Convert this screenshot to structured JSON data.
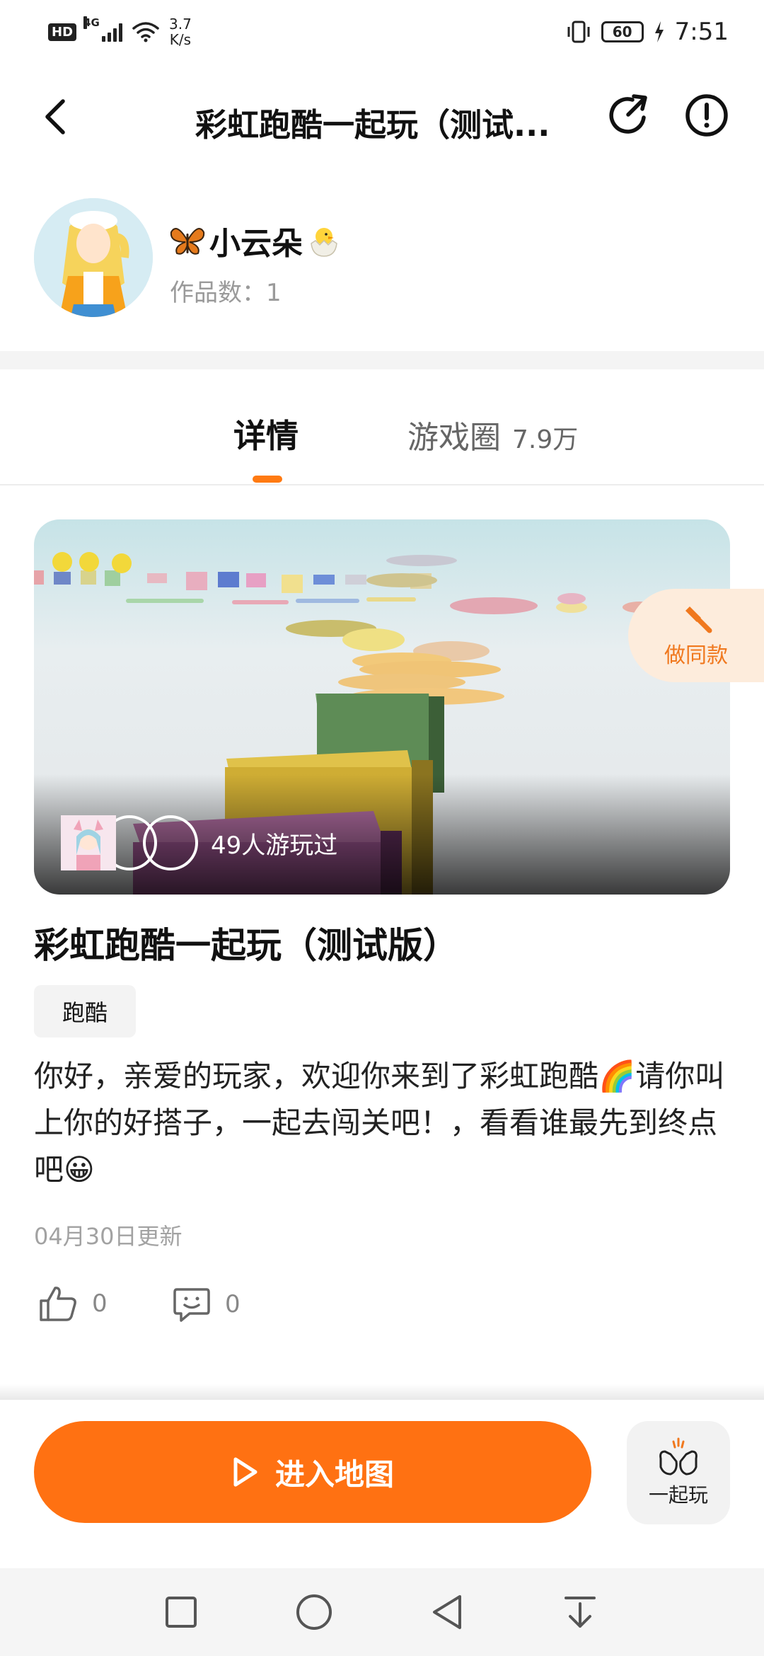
{
  "status_bar": {
    "hd": "HD",
    "network": "4G",
    "speed_value": "3.7",
    "speed_unit": "K/s",
    "battery": "60",
    "time": "7:51"
  },
  "header": {
    "title": "彩虹跑酷一起玩（测试..."
  },
  "author": {
    "name": "小云朵",
    "works_label": "作品数：",
    "works_count": "1"
  },
  "tabs": {
    "detail_label": "详情",
    "circle_label": "游戏圈",
    "circle_count": "7.9万"
  },
  "cover": {
    "players_text": "49人游玩过",
    "make_same_label": "做同款"
  },
  "game": {
    "title": "彩虹跑酷一起玩（测试版）",
    "tag": "跑酷",
    "description": "你好，亲爱的玩家，欢迎你来到了彩虹跑酷🌈请你叫上你的好搭子，一起去闯关吧！，看看谁最先到终点吧😀",
    "update_date": "04月30日更新",
    "likes": "0",
    "comments": "0"
  },
  "bottom_bar": {
    "enter_label": "进入地图",
    "together_label": "一起玩"
  },
  "colors": {
    "accent": "#ff7112",
    "make_same_bg": "#fdecdc",
    "make_same_text": "#f0781e"
  },
  "icons": [
    "back-icon",
    "share-icon",
    "info-icon",
    "butterfly-icon",
    "chick-icon",
    "hammer-icon",
    "thumbs-up-icon",
    "comment-icon",
    "play-icon",
    "clap-icon",
    "square-nav-icon",
    "circle-nav-icon",
    "triangle-nav-icon",
    "download-nav-icon"
  ]
}
